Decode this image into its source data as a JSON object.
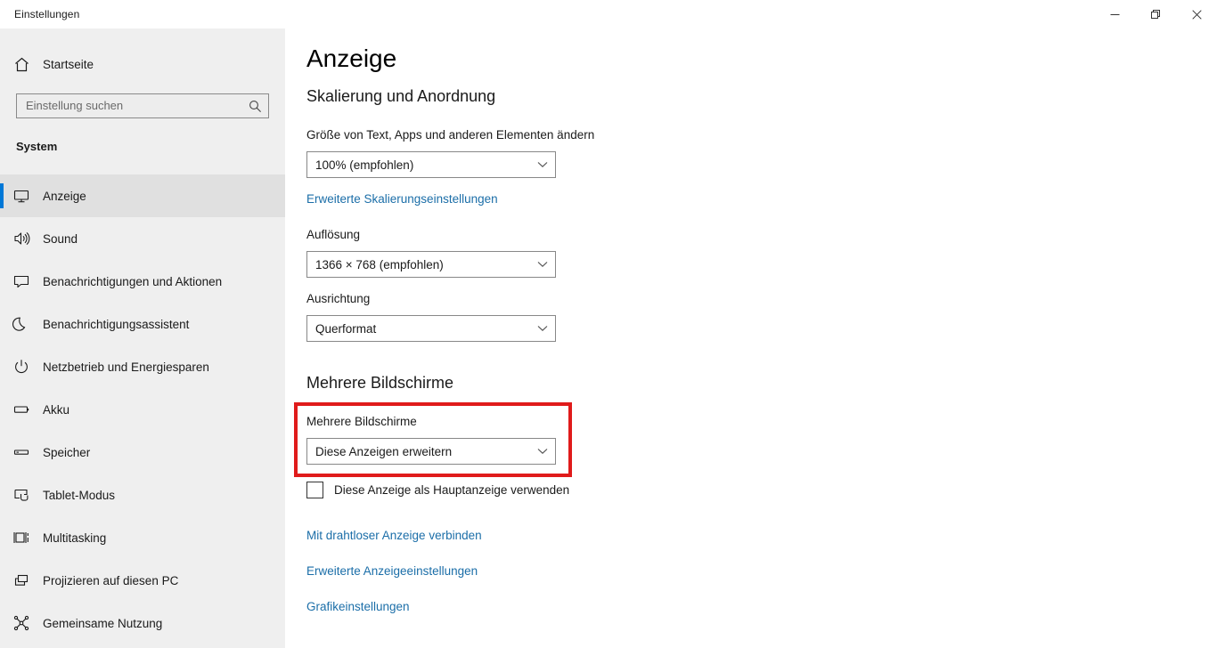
{
  "window": {
    "title": "Einstellungen",
    "controls": {
      "minimize": "minimize-button",
      "restore": "restore-button",
      "close": "close-button"
    }
  },
  "sidebar": {
    "home": {
      "label": "Startseite",
      "icon": "home-icon"
    },
    "search": {
      "value": "",
      "placeholder": "Einstellung suchen",
      "icon": "search-icon"
    },
    "section_label": "System",
    "accent_color": "#0078d7",
    "items": [
      {
        "label": "Anzeige",
        "icon": "monitor-icon",
        "selected": true
      },
      {
        "label": "Sound",
        "icon": "speaker-icon",
        "selected": false
      },
      {
        "label": "Benachrichtigungen und Aktionen",
        "icon": "notification-icon",
        "selected": false
      },
      {
        "label": "Benachrichtigungsassistent",
        "icon": "moon-icon",
        "selected": false
      },
      {
        "label": "Netzbetrieb und Energiesparen",
        "icon": "power-icon",
        "selected": false
      },
      {
        "label": "Akku",
        "icon": "battery-icon",
        "selected": false
      },
      {
        "label": "Speicher",
        "icon": "storage-icon",
        "selected": false
      },
      {
        "label": "Tablet-Modus",
        "icon": "tablet-icon",
        "selected": false
      },
      {
        "label": "Multitasking",
        "icon": "multitasking-icon",
        "selected": false
      },
      {
        "label": "Projizieren auf diesen PC",
        "icon": "project-icon",
        "selected": false
      },
      {
        "label": "Gemeinsame Nutzung",
        "icon": "share-icon",
        "selected": false
      }
    ]
  },
  "main": {
    "page_title": "Anzeige",
    "scaling_section": {
      "heading": "Skalierung und Anordnung",
      "scale_label": "Größe von Text, Apps und anderen Elementen ändern",
      "scale_value": "100% (empfohlen)",
      "advanced_scaling_link": "Erweiterte Skalierungseinstellungen",
      "resolution_label": "Auflösung",
      "resolution_value": "1366 × 768 (empfohlen)",
      "orientation_label": "Ausrichtung",
      "orientation_value": "Querformat"
    },
    "multi_display_section": {
      "heading": "Mehrere Bildschirme",
      "mode_label": "Mehrere Bildschirme",
      "mode_value": "Diese Anzeigen erweitern",
      "main_display_checkbox_label": "Diese Anzeige als Hauptanzeige verwenden",
      "main_display_checked": false,
      "highlight_color": "#e01b1b"
    },
    "links": [
      "Mit drahtloser Anzeige verbinden",
      "Erweiterte Anzeigeeinstellungen",
      "Grafikeinstellungen"
    ]
  }
}
